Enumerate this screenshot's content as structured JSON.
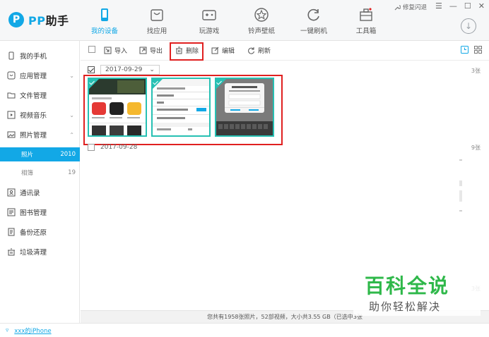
{
  "app": {
    "logo_badge": "P",
    "logo_brand": "PP",
    "logo_suffix": "助手"
  },
  "nav": [
    {
      "label": "我的设备",
      "icon": "phone-icon",
      "active": true
    },
    {
      "label": "找应用",
      "icon": "bag-icon",
      "active": false
    },
    {
      "label": "玩游戏",
      "icon": "gamepad-icon",
      "active": false
    },
    {
      "label": "铃声壁纸",
      "icon": "star-icon",
      "active": false
    },
    {
      "label": "一键刷机",
      "icon": "refresh-icon",
      "active": false
    },
    {
      "label": "工具箱",
      "icon": "toolbox-icon",
      "active": false
    }
  ],
  "titlebar": {
    "repair_label": "修复闪退",
    "menu_glyph": "☰",
    "minimize_glyph": "—",
    "maximize_glyph": "☐",
    "close_glyph": "✕",
    "download_glyph": "↓",
    "accent": "#12a8e6"
  },
  "sidebar": {
    "items": [
      {
        "label": "我的手机",
        "icon": "phone-outline-icon"
      },
      {
        "label": "应用管理",
        "icon": "app-icon",
        "chevron": "⌄"
      },
      {
        "label": "文件管理",
        "icon": "folder-icon"
      },
      {
        "label": "视频音乐",
        "icon": "play-icon",
        "chevron": "⌄"
      },
      {
        "label": "照片管理",
        "icon": "image-icon",
        "chevron": "⌃"
      },
      {
        "label": "通讯录",
        "icon": "contacts-icon"
      },
      {
        "label": "图书管理",
        "icon": "book-icon"
      },
      {
        "label": "备份还原",
        "icon": "backup-icon"
      },
      {
        "label": "垃圾清理",
        "icon": "trash-bin-icon"
      }
    ],
    "sub_items": [
      {
        "label": "照片",
        "count": "2010",
        "active": true
      },
      {
        "label": "相簿",
        "count": "19",
        "active": false
      }
    ]
  },
  "toolbar": {
    "import_label": "导入",
    "export_label": "导出",
    "delete_label": "删除",
    "edit_label": "编辑",
    "refresh_label": "刷新"
  },
  "groups": [
    {
      "date": "2017-09-29",
      "count": "3张",
      "caret": "⌄"
    },
    {
      "date": "2017-09-28",
      "count": "9张"
    }
  ],
  "third_count": "3张",
  "photos": [
    {
      "title": "Game thumbnail collage",
      "kind": "appstore"
    },
    {
      "title": "Settings form",
      "kind": "form"
    },
    {
      "title": "Keyboard dialog",
      "kind": "dialog"
    }
  ],
  "statusbar": {
    "text": "您共有1958张照片，52部视频，大小共3.55 GB（已选中3张"
  },
  "bottom": {
    "device_name": "xxx的iPhone",
    "wifi_glyph": "▿"
  },
  "watermark": {
    "title": "百科全说",
    "subtitle": "助你轻松解决",
    "color": "#2fb84a"
  }
}
